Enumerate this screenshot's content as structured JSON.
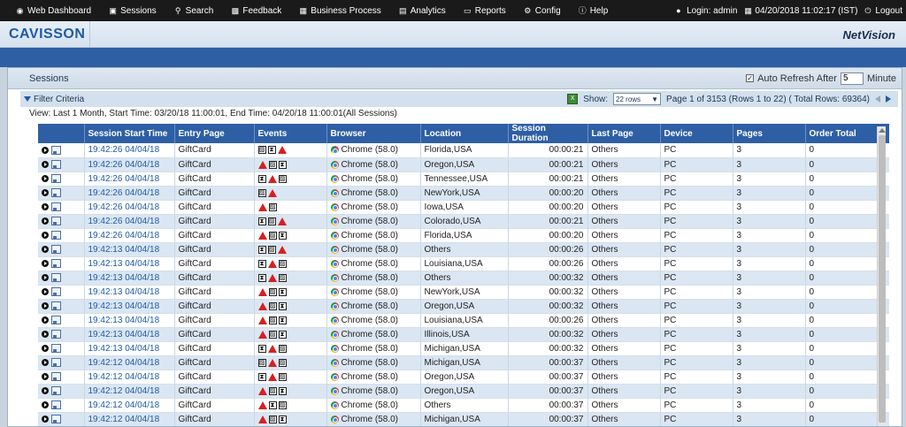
{
  "nav": {
    "items": [
      {
        "label": "Web Dashboard",
        "icon": "dashboard-icon"
      },
      {
        "label": "Sessions",
        "icon": "sessions-icon"
      },
      {
        "label": "Search",
        "icon": "search-icon"
      },
      {
        "label": "Feedback",
        "icon": "feedback-icon"
      },
      {
        "label": "Business Process",
        "icon": "business-process-icon"
      },
      {
        "label": "Analytics",
        "icon": "analytics-icon"
      },
      {
        "label": "Reports",
        "icon": "reports-icon"
      },
      {
        "label": "Config",
        "icon": "config-icon"
      },
      {
        "label": "Help",
        "icon": "help-icon"
      }
    ],
    "login": "Login: admin",
    "datetime": "04/20/2018 11:02:17 (IST)",
    "logout": "Logout"
  },
  "brand": {
    "logo": "CAVISSON",
    "product": "NetVision"
  },
  "panel": {
    "title": "Sessions",
    "auto_refresh_label": "Auto Refresh After",
    "auto_refresh_value": "5",
    "auto_refresh_unit": "Minute"
  },
  "filter": {
    "label": "Filter Criteria",
    "show_label": "Show:",
    "rows_option": "22 rows",
    "pager": "Page 1 of 3153 (Rows 1 to 22) ( Total Rows: 69364)",
    "view_line": "View: Last 1 Month, Start Time: 03/20/18 11:00:01, End Time: 04/20/18 11:00:01(All Sessions)"
  },
  "colors": {
    "accent": "#2e5fa5",
    "alert": "#d62020",
    "link": "#1f5aa6"
  },
  "table": {
    "headers": [
      "",
      "Session Start Time",
      "Entry Page",
      "Events",
      "Browser",
      "Location",
      "Session Duration",
      "Last Page",
      "Device",
      "Pages",
      "Order Total"
    ],
    "rows": [
      {
        "time": "19:42:26 04/04/18",
        "entry": "GiftCard",
        "events": [
          "img",
          "hour",
          "alert"
        ],
        "browser": "Chrome (58.0)",
        "location": "Florida,USA",
        "duration": "00:00:21",
        "last": "Others",
        "device": "PC",
        "pages": "3",
        "order": "0"
      },
      {
        "time": "19:42:26 04/04/18",
        "entry": "GiftCard",
        "events": [
          "alert",
          "img",
          "hour"
        ],
        "browser": "Chrome (58.0)",
        "location": "Oregon,USA",
        "duration": "00:00:21",
        "last": "Others",
        "device": "PC",
        "pages": "3",
        "order": "0"
      },
      {
        "time": "19:42:26 04/04/18",
        "entry": "GiftCard",
        "events": [
          "hour",
          "alert",
          "img"
        ],
        "browser": "Chrome (58.0)",
        "location": "Tennessee,USA",
        "duration": "00:00:21",
        "last": "Others",
        "device": "PC",
        "pages": "3",
        "order": "0"
      },
      {
        "time": "19:42:26 04/04/18",
        "entry": "GiftCard",
        "events": [
          "img",
          "alert"
        ],
        "browser": "Chrome (58.0)",
        "location": "NewYork,USA",
        "duration": "00:00:20",
        "last": "Others",
        "device": "PC",
        "pages": "3",
        "order": "0"
      },
      {
        "time": "19:42:26 04/04/18",
        "entry": "GiftCard",
        "events": [
          "alert",
          "img"
        ],
        "browser": "Chrome (58.0)",
        "location": "Iowa,USA",
        "duration": "00:00:20",
        "last": "Others",
        "device": "PC",
        "pages": "3",
        "order": "0"
      },
      {
        "time": "19:42:26 04/04/18",
        "entry": "GiftCard",
        "events": [
          "hour",
          "img",
          "alert"
        ],
        "browser": "Chrome (58.0)",
        "location": "Colorado,USA",
        "duration": "00:00:21",
        "last": "Others",
        "device": "PC",
        "pages": "3",
        "order": "0"
      },
      {
        "time": "19:42:26 04/04/18",
        "entry": "GiftCard",
        "events": [
          "alert",
          "img",
          "hour"
        ],
        "browser": "Chrome (58.0)",
        "location": "Florida,USA",
        "duration": "00:00:20",
        "last": "Others",
        "device": "PC",
        "pages": "3",
        "order": "0"
      },
      {
        "time": "19:42:13 04/04/18",
        "entry": "GiftCard",
        "events": [
          "hour",
          "img",
          "alert"
        ],
        "browser": "Chrome (58.0)",
        "location": "Others",
        "duration": "00:00:26",
        "last": "Others",
        "device": "PC",
        "pages": "3",
        "order": "0"
      },
      {
        "time": "19:42:13 04/04/18",
        "entry": "GiftCard",
        "events": [
          "hour",
          "alert",
          "img"
        ],
        "browser": "Chrome (58.0)",
        "location": "Louisiana,USA",
        "duration": "00:00:26",
        "last": "Others",
        "device": "PC",
        "pages": "3",
        "order": "0"
      },
      {
        "time": "19:42:13 04/04/18",
        "entry": "GiftCard",
        "events": [
          "hour",
          "alert",
          "img"
        ],
        "browser": "Chrome (58.0)",
        "location": "Others",
        "duration": "00:00:32",
        "last": "Others",
        "device": "PC",
        "pages": "3",
        "order": "0"
      },
      {
        "time": "19:42:13 04/04/18",
        "entry": "GiftCard",
        "events": [
          "alert",
          "img",
          "hour"
        ],
        "browser": "Chrome (58.0)",
        "location": "NewYork,USA",
        "duration": "00:00:32",
        "last": "Others",
        "device": "PC",
        "pages": "3",
        "order": "0"
      },
      {
        "time": "19:42:13 04/04/18",
        "entry": "GiftCard",
        "events": [
          "alert",
          "img",
          "hour"
        ],
        "browser": "Chrome (58.0)",
        "location": "Oregon,USA",
        "duration": "00:00:32",
        "last": "Others",
        "device": "PC",
        "pages": "3",
        "order": "0"
      },
      {
        "time": "19:42:13 04/04/18",
        "entry": "GiftCard",
        "events": [
          "alert",
          "img",
          "hour"
        ],
        "browser": "Chrome (58.0)",
        "location": "Louisiana,USA",
        "duration": "00:00:26",
        "last": "Others",
        "device": "PC",
        "pages": "3",
        "order": "0"
      },
      {
        "time": "19:42:13 04/04/18",
        "entry": "GiftCard",
        "events": [
          "alert",
          "img",
          "hour"
        ],
        "browser": "Chrome (58.0)",
        "location": "Illinois,USA",
        "duration": "00:00:32",
        "last": "Others",
        "device": "PC",
        "pages": "3",
        "order": "0"
      },
      {
        "time": "19:42:13 04/04/18",
        "entry": "GiftCard",
        "events": [
          "hour",
          "alert",
          "img"
        ],
        "browser": "Chrome (58.0)",
        "location": "Michigan,USA",
        "duration": "00:00:32",
        "last": "Others",
        "device": "PC",
        "pages": "3",
        "order": "0"
      },
      {
        "time": "19:42:12 04/04/18",
        "entry": "GiftCard",
        "events": [
          "img",
          "alert",
          "img"
        ],
        "browser": "Chrome (58.0)",
        "location": "Michigan,USA",
        "duration": "00:00:37",
        "last": "Others",
        "device": "PC",
        "pages": "3",
        "order": "0"
      },
      {
        "time": "19:42:12 04/04/18",
        "entry": "GiftCard",
        "events": [
          "hour",
          "alert",
          "img"
        ],
        "browser": "Chrome (58.0)",
        "location": "Oregon,USA",
        "duration": "00:00:37",
        "last": "Others",
        "device": "PC",
        "pages": "3",
        "order": "0"
      },
      {
        "time": "19:42:12 04/04/18",
        "entry": "GiftCard",
        "events": [
          "alert",
          "img",
          "hour"
        ],
        "browser": "Chrome (58.0)",
        "location": "Oregon,USA",
        "duration": "00:00:37",
        "last": "Others",
        "device": "PC",
        "pages": "3",
        "order": "0"
      },
      {
        "time": "19:42:12 04/04/18",
        "entry": "GiftCard",
        "events": [
          "alert",
          "hour",
          "img"
        ],
        "browser": "Chrome (58.0)",
        "location": "Others",
        "duration": "00:00:37",
        "last": "Others",
        "device": "PC",
        "pages": "3",
        "order": "0"
      },
      {
        "time": "19:42:12 04/04/18",
        "entry": "GiftCard",
        "events": [
          "alert",
          "img",
          "hour"
        ],
        "browser": "Chrome (58.0)",
        "location": "Michigan,USA",
        "duration": "00:00:37",
        "last": "Others",
        "device": "PC",
        "pages": "3",
        "order": "0"
      }
    ]
  }
}
